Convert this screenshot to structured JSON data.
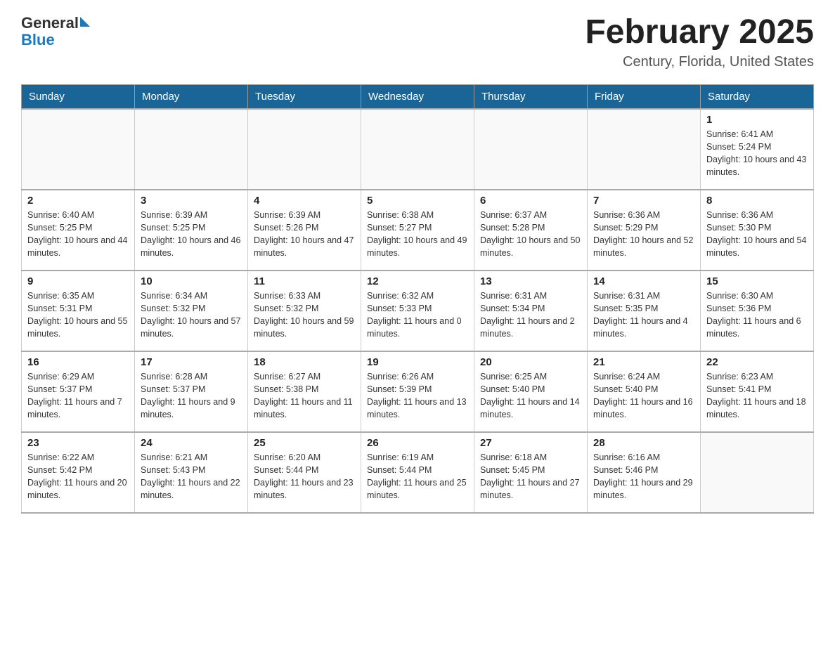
{
  "header": {
    "logo_general": "General",
    "logo_blue": "Blue",
    "month_title": "February 2025",
    "location": "Century, Florida, United States"
  },
  "days_of_week": [
    "Sunday",
    "Monday",
    "Tuesday",
    "Wednesday",
    "Thursday",
    "Friday",
    "Saturday"
  ],
  "weeks": [
    [
      {
        "day": "",
        "info": ""
      },
      {
        "day": "",
        "info": ""
      },
      {
        "day": "",
        "info": ""
      },
      {
        "day": "",
        "info": ""
      },
      {
        "day": "",
        "info": ""
      },
      {
        "day": "",
        "info": ""
      },
      {
        "day": "1",
        "info": "Sunrise: 6:41 AM\nSunset: 5:24 PM\nDaylight: 10 hours and 43 minutes."
      }
    ],
    [
      {
        "day": "2",
        "info": "Sunrise: 6:40 AM\nSunset: 5:25 PM\nDaylight: 10 hours and 44 minutes."
      },
      {
        "day": "3",
        "info": "Sunrise: 6:39 AM\nSunset: 5:25 PM\nDaylight: 10 hours and 46 minutes."
      },
      {
        "day": "4",
        "info": "Sunrise: 6:39 AM\nSunset: 5:26 PM\nDaylight: 10 hours and 47 minutes."
      },
      {
        "day": "5",
        "info": "Sunrise: 6:38 AM\nSunset: 5:27 PM\nDaylight: 10 hours and 49 minutes."
      },
      {
        "day": "6",
        "info": "Sunrise: 6:37 AM\nSunset: 5:28 PM\nDaylight: 10 hours and 50 minutes."
      },
      {
        "day": "7",
        "info": "Sunrise: 6:36 AM\nSunset: 5:29 PM\nDaylight: 10 hours and 52 minutes."
      },
      {
        "day": "8",
        "info": "Sunrise: 6:36 AM\nSunset: 5:30 PM\nDaylight: 10 hours and 54 minutes."
      }
    ],
    [
      {
        "day": "9",
        "info": "Sunrise: 6:35 AM\nSunset: 5:31 PM\nDaylight: 10 hours and 55 minutes."
      },
      {
        "day": "10",
        "info": "Sunrise: 6:34 AM\nSunset: 5:32 PM\nDaylight: 10 hours and 57 minutes."
      },
      {
        "day": "11",
        "info": "Sunrise: 6:33 AM\nSunset: 5:32 PM\nDaylight: 10 hours and 59 minutes."
      },
      {
        "day": "12",
        "info": "Sunrise: 6:32 AM\nSunset: 5:33 PM\nDaylight: 11 hours and 0 minutes."
      },
      {
        "day": "13",
        "info": "Sunrise: 6:31 AM\nSunset: 5:34 PM\nDaylight: 11 hours and 2 minutes."
      },
      {
        "day": "14",
        "info": "Sunrise: 6:31 AM\nSunset: 5:35 PM\nDaylight: 11 hours and 4 minutes."
      },
      {
        "day": "15",
        "info": "Sunrise: 6:30 AM\nSunset: 5:36 PM\nDaylight: 11 hours and 6 minutes."
      }
    ],
    [
      {
        "day": "16",
        "info": "Sunrise: 6:29 AM\nSunset: 5:37 PM\nDaylight: 11 hours and 7 minutes."
      },
      {
        "day": "17",
        "info": "Sunrise: 6:28 AM\nSunset: 5:37 PM\nDaylight: 11 hours and 9 minutes."
      },
      {
        "day": "18",
        "info": "Sunrise: 6:27 AM\nSunset: 5:38 PM\nDaylight: 11 hours and 11 minutes."
      },
      {
        "day": "19",
        "info": "Sunrise: 6:26 AM\nSunset: 5:39 PM\nDaylight: 11 hours and 13 minutes."
      },
      {
        "day": "20",
        "info": "Sunrise: 6:25 AM\nSunset: 5:40 PM\nDaylight: 11 hours and 14 minutes."
      },
      {
        "day": "21",
        "info": "Sunrise: 6:24 AM\nSunset: 5:40 PM\nDaylight: 11 hours and 16 minutes."
      },
      {
        "day": "22",
        "info": "Sunrise: 6:23 AM\nSunset: 5:41 PM\nDaylight: 11 hours and 18 minutes."
      }
    ],
    [
      {
        "day": "23",
        "info": "Sunrise: 6:22 AM\nSunset: 5:42 PM\nDaylight: 11 hours and 20 minutes."
      },
      {
        "day": "24",
        "info": "Sunrise: 6:21 AM\nSunset: 5:43 PM\nDaylight: 11 hours and 22 minutes."
      },
      {
        "day": "25",
        "info": "Sunrise: 6:20 AM\nSunset: 5:44 PM\nDaylight: 11 hours and 23 minutes."
      },
      {
        "day": "26",
        "info": "Sunrise: 6:19 AM\nSunset: 5:44 PM\nDaylight: 11 hours and 25 minutes."
      },
      {
        "day": "27",
        "info": "Sunrise: 6:18 AM\nSunset: 5:45 PM\nDaylight: 11 hours and 27 minutes."
      },
      {
        "day": "28",
        "info": "Sunrise: 6:16 AM\nSunset: 5:46 PM\nDaylight: 11 hours and 29 minutes."
      },
      {
        "day": "",
        "info": ""
      }
    ]
  ]
}
